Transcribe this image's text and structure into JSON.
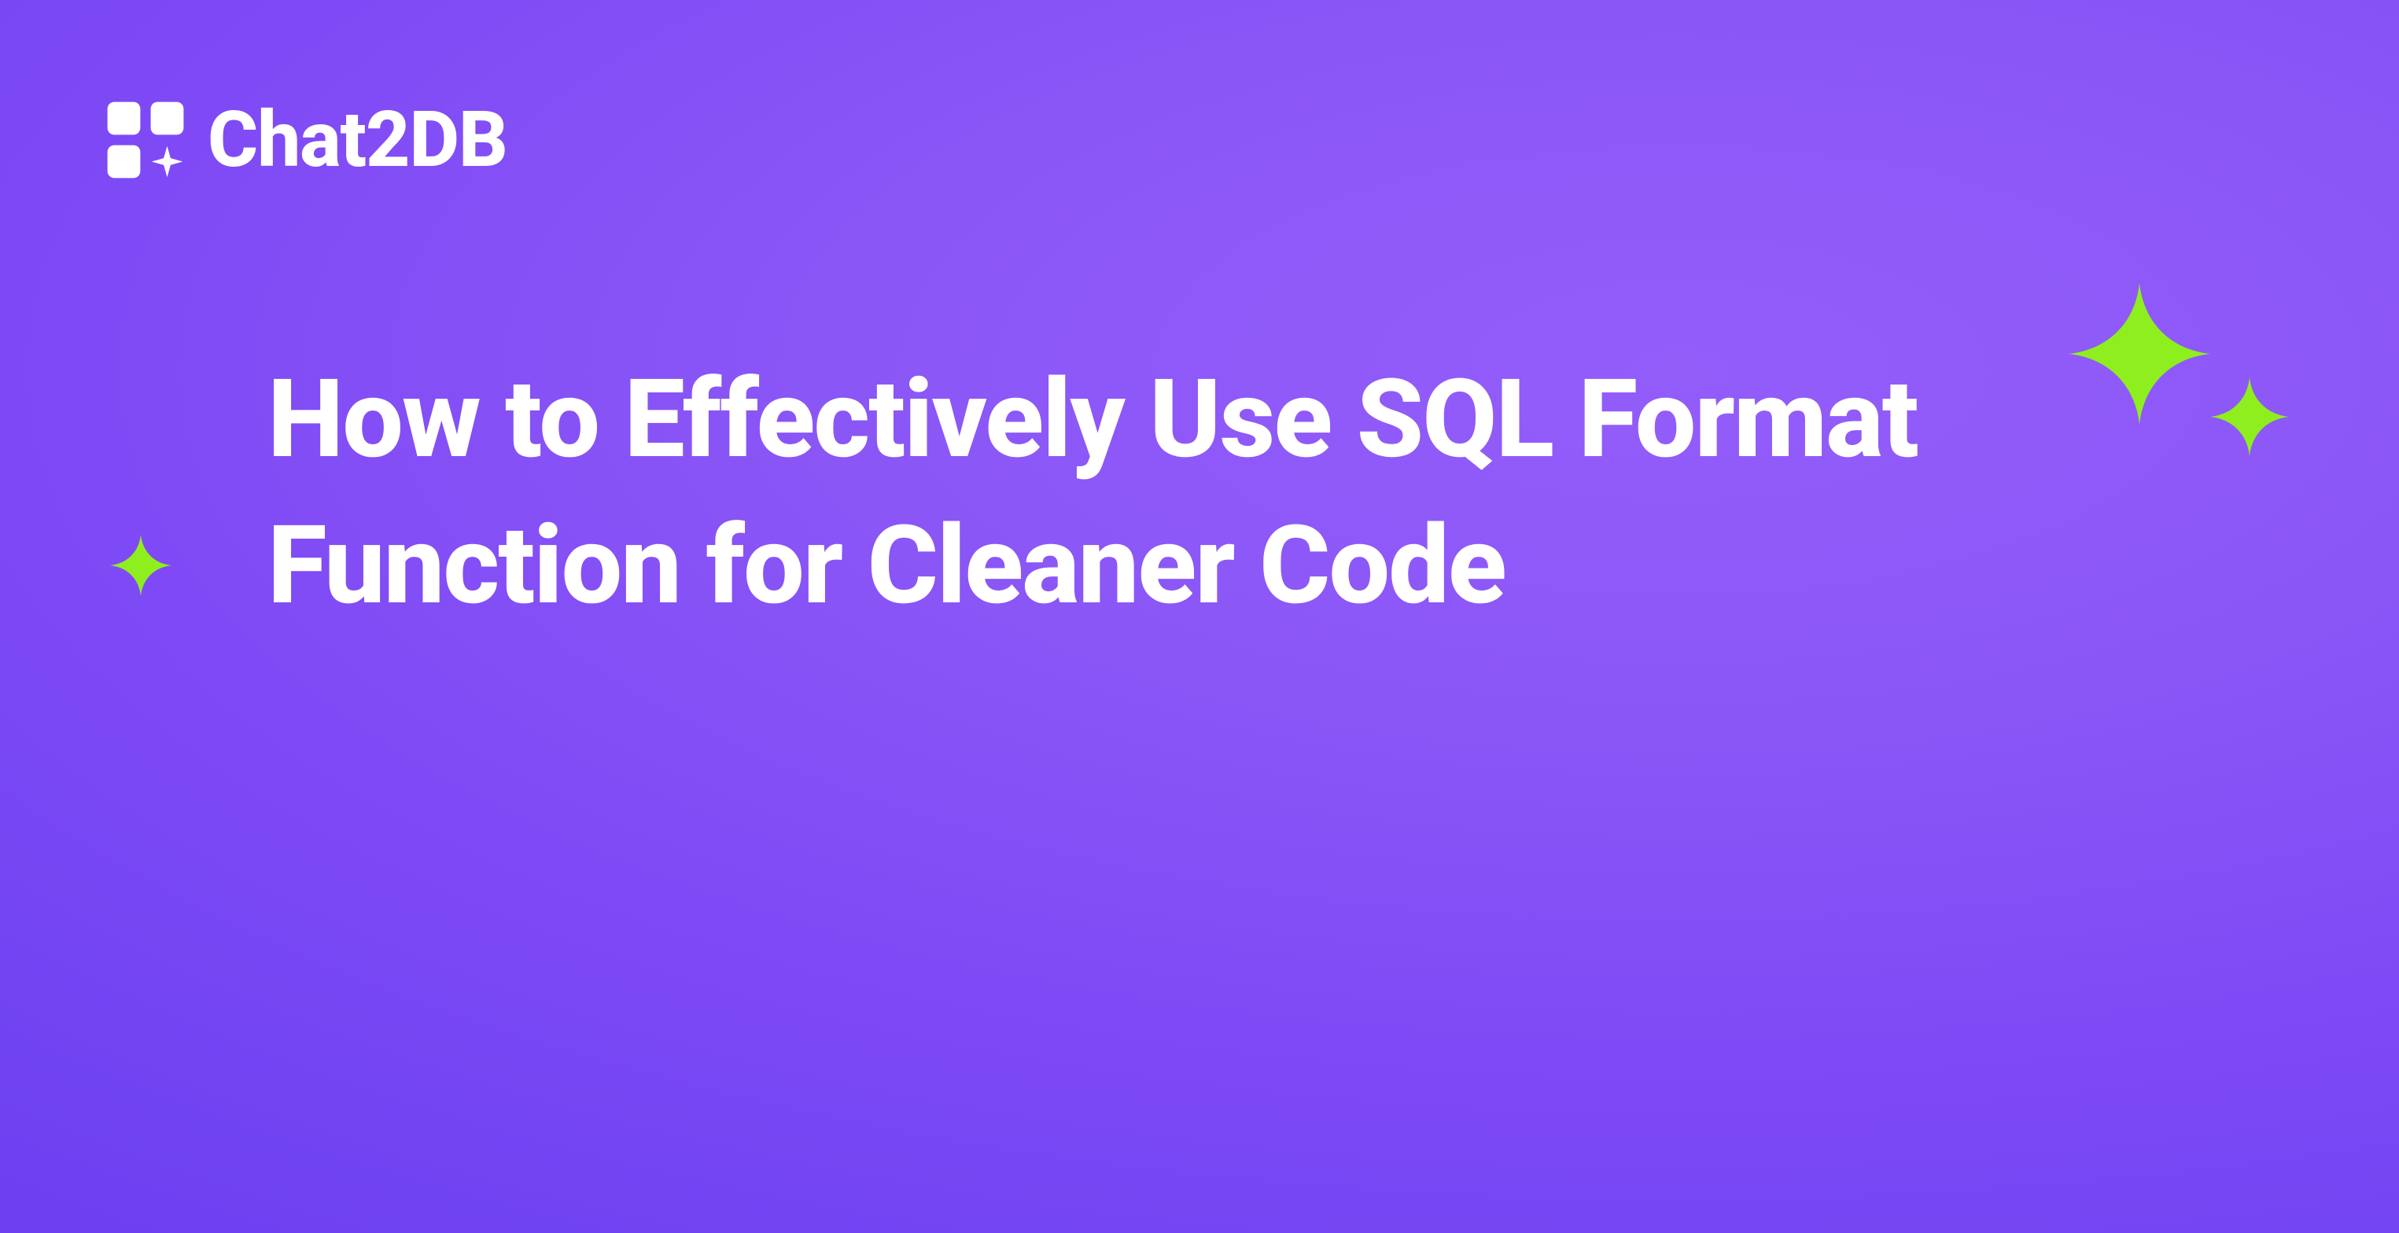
{
  "brand": {
    "name": "Chat2DB"
  },
  "title": "How to Effectively Use SQL Format Function for Cleaner Code",
  "colors": {
    "accent": "#8fef1e",
    "text": "#ffffff",
    "bg_start": "#935dfa",
    "bg_end": "#6939ee"
  }
}
